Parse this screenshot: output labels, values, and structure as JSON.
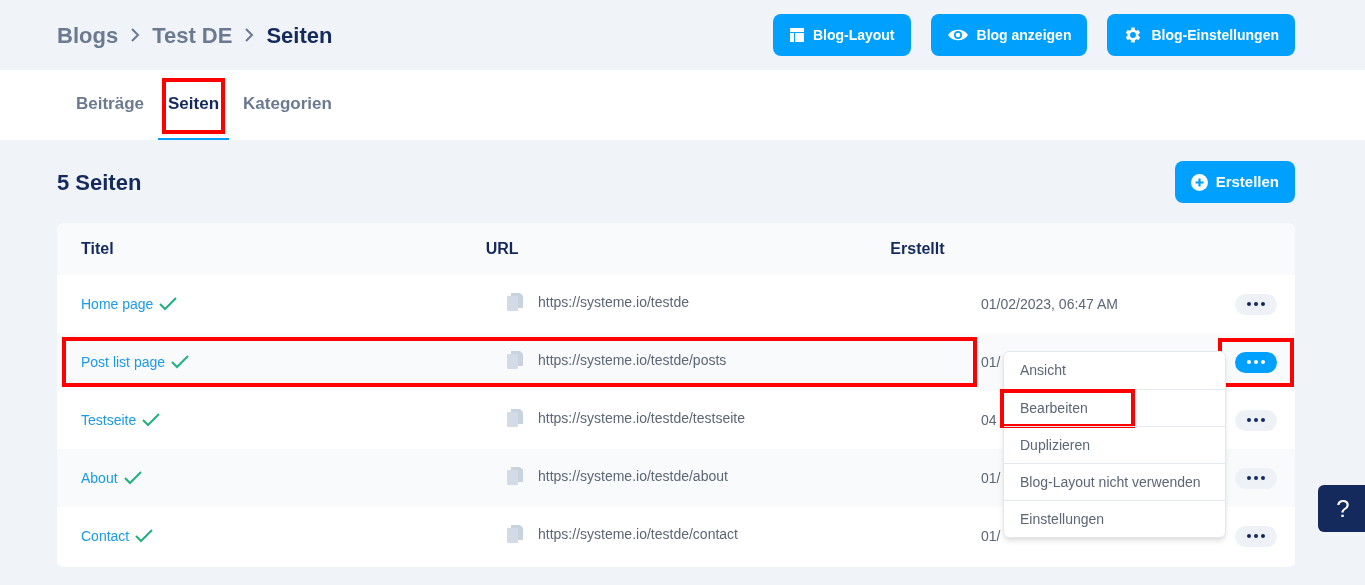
{
  "breadcrumb": [
    {
      "label": "Blogs",
      "current": false
    },
    {
      "label": "Test DE",
      "current": false
    },
    {
      "label": "Seiten",
      "current": true
    }
  ],
  "header_buttons": [
    {
      "kind": "layout",
      "label": "Blog-Layout"
    },
    {
      "kind": "view",
      "label": "Blog anzeigen"
    },
    {
      "kind": "settings",
      "label": "Blog-Einstellungen"
    }
  ],
  "tabs": [
    {
      "label": "Beiträge",
      "selected": false,
      "highlighted": false
    },
    {
      "label": "Seiten",
      "selected": true,
      "highlighted": true
    },
    {
      "label": "Kategorien",
      "selected": false,
      "highlighted": false
    }
  ],
  "heading": "5 Seiten",
  "create_button": "Erstellen",
  "table": {
    "columns": [
      "Titel",
      "URL",
      "Erstellt"
    ],
    "rows": [
      {
        "title": "Home page",
        "published": true,
        "url": "https://systeme.io/testde",
        "created": "01/02/2023, 06:47 AM",
        "highlighted": false,
        "menu_open": false
      },
      {
        "title": "Post list page",
        "published": true,
        "url": "https://systeme.io/testde/posts",
        "created": "01/",
        "highlighted": true,
        "menu_open": true
      },
      {
        "title": "Testseite",
        "published": true,
        "url": "https://systeme.io/testde/testseite",
        "created": "04",
        "highlighted": false,
        "menu_open": false
      },
      {
        "title": "About",
        "published": true,
        "url": "https://systeme.io/testde/about",
        "created": "01/",
        "highlighted": false,
        "menu_open": false
      },
      {
        "title": "Contact",
        "published": true,
        "url": "https://systeme.io/testde/contact",
        "created": "01/",
        "highlighted": false,
        "menu_open": false
      }
    ]
  },
  "menu": [
    {
      "label": "Ansicht",
      "highlighted": false
    },
    {
      "label": "Bearbeiten",
      "highlighted": true
    },
    {
      "label": "Duplizieren",
      "highlighted": false
    },
    {
      "label": "Blog-Layout nicht verwenden",
      "highlighted": false
    },
    {
      "label": "Einstellungen",
      "highlighted": false
    }
  ],
  "help_button": "?"
}
